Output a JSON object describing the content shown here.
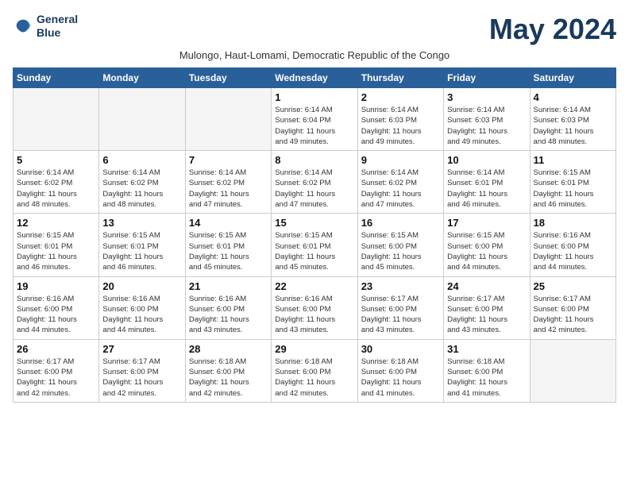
{
  "header": {
    "logo_line1": "General",
    "logo_line2": "Blue",
    "month_title": "May 2024",
    "subtitle": "Mulongo, Haut-Lomami, Democratic Republic of the Congo"
  },
  "days_of_week": [
    "Sunday",
    "Monday",
    "Tuesday",
    "Wednesday",
    "Thursday",
    "Friday",
    "Saturday"
  ],
  "weeks": [
    [
      {
        "day": "",
        "info": ""
      },
      {
        "day": "",
        "info": ""
      },
      {
        "day": "",
        "info": ""
      },
      {
        "day": "1",
        "info": "Sunrise: 6:14 AM\nSunset: 6:04 PM\nDaylight: 11 hours\nand 49 minutes."
      },
      {
        "day": "2",
        "info": "Sunrise: 6:14 AM\nSunset: 6:03 PM\nDaylight: 11 hours\nand 49 minutes."
      },
      {
        "day": "3",
        "info": "Sunrise: 6:14 AM\nSunset: 6:03 PM\nDaylight: 11 hours\nand 49 minutes."
      },
      {
        "day": "4",
        "info": "Sunrise: 6:14 AM\nSunset: 6:03 PM\nDaylight: 11 hours\nand 48 minutes."
      }
    ],
    [
      {
        "day": "5",
        "info": "Sunrise: 6:14 AM\nSunset: 6:02 PM\nDaylight: 11 hours\nand 48 minutes."
      },
      {
        "day": "6",
        "info": "Sunrise: 6:14 AM\nSunset: 6:02 PM\nDaylight: 11 hours\nand 48 minutes."
      },
      {
        "day": "7",
        "info": "Sunrise: 6:14 AM\nSunset: 6:02 PM\nDaylight: 11 hours\nand 47 minutes."
      },
      {
        "day": "8",
        "info": "Sunrise: 6:14 AM\nSunset: 6:02 PM\nDaylight: 11 hours\nand 47 minutes."
      },
      {
        "day": "9",
        "info": "Sunrise: 6:14 AM\nSunset: 6:02 PM\nDaylight: 11 hours\nand 47 minutes."
      },
      {
        "day": "10",
        "info": "Sunrise: 6:14 AM\nSunset: 6:01 PM\nDaylight: 11 hours\nand 46 minutes."
      },
      {
        "day": "11",
        "info": "Sunrise: 6:15 AM\nSunset: 6:01 PM\nDaylight: 11 hours\nand 46 minutes."
      }
    ],
    [
      {
        "day": "12",
        "info": "Sunrise: 6:15 AM\nSunset: 6:01 PM\nDaylight: 11 hours\nand 46 minutes."
      },
      {
        "day": "13",
        "info": "Sunrise: 6:15 AM\nSunset: 6:01 PM\nDaylight: 11 hours\nand 46 minutes."
      },
      {
        "day": "14",
        "info": "Sunrise: 6:15 AM\nSunset: 6:01 PM\nDaylight: 11 hours\nand 45 minutes."
      },
      {
        "day": "15",
        "info": "Sunrise: 6:15 AM\nSunset: 6:01 PM\nDaylight: 11 hours\nand 45 minutes."
      },
      {
        "day": "16",
        "info": "Sunrise: 6:15 AM\nSunset: 6:00 PM\nDaylight: 11 hours\nand 45 minutes."
      },
      {
        "day": "17",
        "info": "Sunrise: 6:15 AM\nSunset: 6:00 PM\nDaylight: 11 hours\nand 44 minutes."
      },
      {
        "day": "18",
        "info": "Sunrise: 6:16 AM\nSunset: 6:00 PM\nDaylight: 11 hours\nand 44 minutes."
      }
    ],
    [
      {
        "day": "19",
        "info": "Sunrise: 6:16 AM\nSunset: 6:00 PM\nDaylight: 11 hours\nand 44 minutes."
      },
      {
        "day": "20",
        "info": "Sunrise: 6:16 AM\nSunset: 6:00 PM\nDaylight: 11 hours\nand 44 minutes."
      },
      {
        "day": "21",
        "info": "Sunrise: 6:16 AM\nSunset: 6:00 PM\nDaylight: 11 hours\nand 43 minutes."
      },
      {
        "day": "22",
        "info": "Sunrise: 6:16 AM\nSunset: 6:00 PM\nDaylight: 11 hours\nand 43 minutes."
      },
      {
        "day": "23",
        "info": "Sunrise: 6:17 AM\nSunset: 6:00 PM\nDaylight: 11 hours\nand 43 minutes."
      },
      {
        "day": "24",
        "info": "Sunrise: 6:17 AM\nSunset: 6:00 PM\nDaylight: 11 hours\nand 43 minutes."
      },
      {
        "day": "25",
        "info": "Sunrise: 6:17 AM\nSunset: 6:00 PM\nDaylight: 11 hours\nand 42 minutes."
      }
    ],
    [
      {
        "day": "26",
        "info": "Sunrise: 6:17 AM\nSunset: 6:00 PM\nDaylight: 11 hours\nand 42 minutes."
      },
      {
        "day": "27",
        "info": "Sunrise: 6:17 AM\nSunset: 6:00 PM\nDaylight: 11 hours\nand 42 minutes."
      },
      {
        "day": "28",
        "info": "Sunrise: 6:18 AM\nSunset: 6:00 PM\nDaylight: 11 hours\nand 42 minutes."
      },
      {
        "day": "29",
        "info": "Sunrise: 6:18 AM\nSunset: 6:00 PM\nDaylight: 11 hours\nand 42 minutes."
      },
      {
        "day": "30",
        "info": "Sunrise: 6:18 AM\nSunset: 6:00 PM\nDaylight: 11 hours\nand 41 minutes."
      },
      {
        "day": "31",
        "info": "Sunrise: 6:18 AM\nSunset: 6:00 PM\nDaylight: 11 hours\nand 41 minutes."
      },
      {
        "day": "",
        "info": ""
      }
    ]
  ]
}
